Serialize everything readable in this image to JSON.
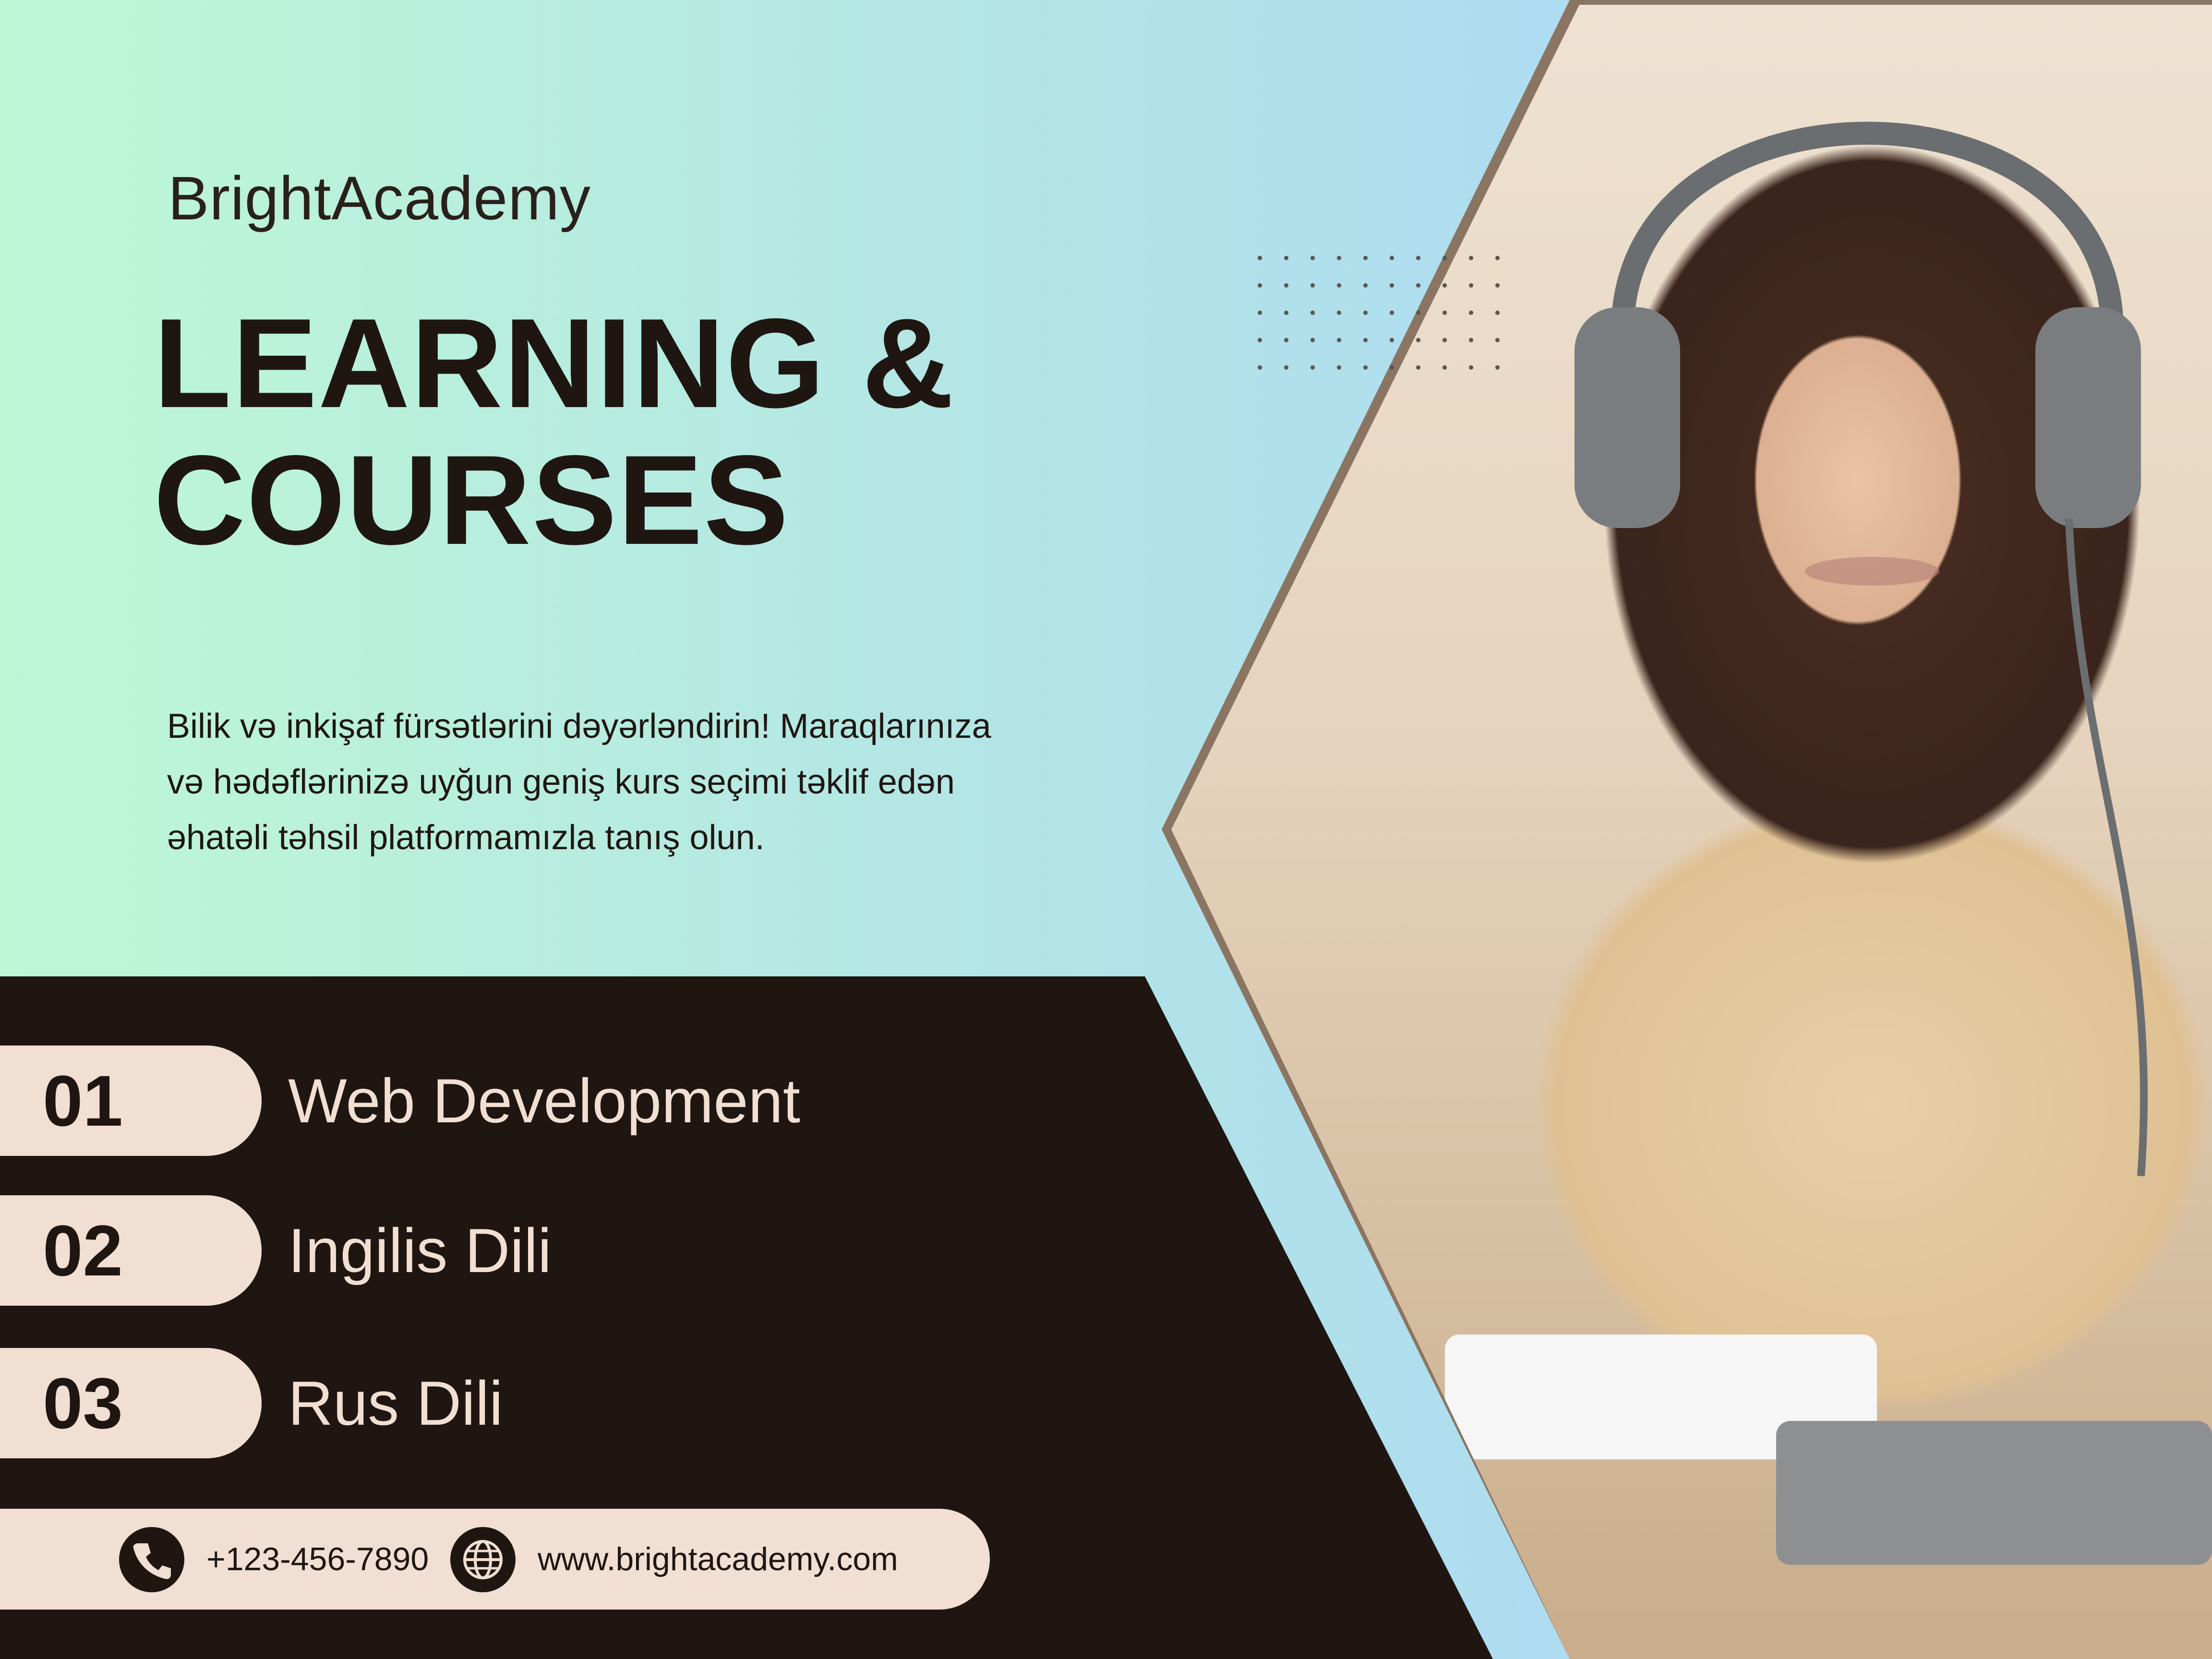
{
  "brand": "BrightAcademy",
  "headline": {
    "line1": "LEARNING &",
    "line2": "COURSES"
  },
  "description": "Bilik və inkişaf fürsətlərini dəyərləndirin! Maraqlarınıza və hədəflərinizə uyğun geniş kurs seçimi təklif edən əhatəli təhsil platformamızla tanış olun.",
  "courses": [
    {
      "number": "01",
      "name": "Web Development"
    },
    {
      "number": "02",
      "name": "Ingilis Dili"
    },
    {
      "number": "03",
      "name": "Rus Dili"
    }
  ],
  "contact": {
    "phone": "+123-456-7890",
    "website": "www.brightacademy.com",
    "phone_icon": "phone-icon",
    "globe_icon": "globe-icon"
  },
  "colors": {
    "dark": "#1f1612",
    "cream": "#f0dfd2",
    "gradient_start": "#bdf7d6",
    "gradient_end": "#a6d0f5"
  }
}
